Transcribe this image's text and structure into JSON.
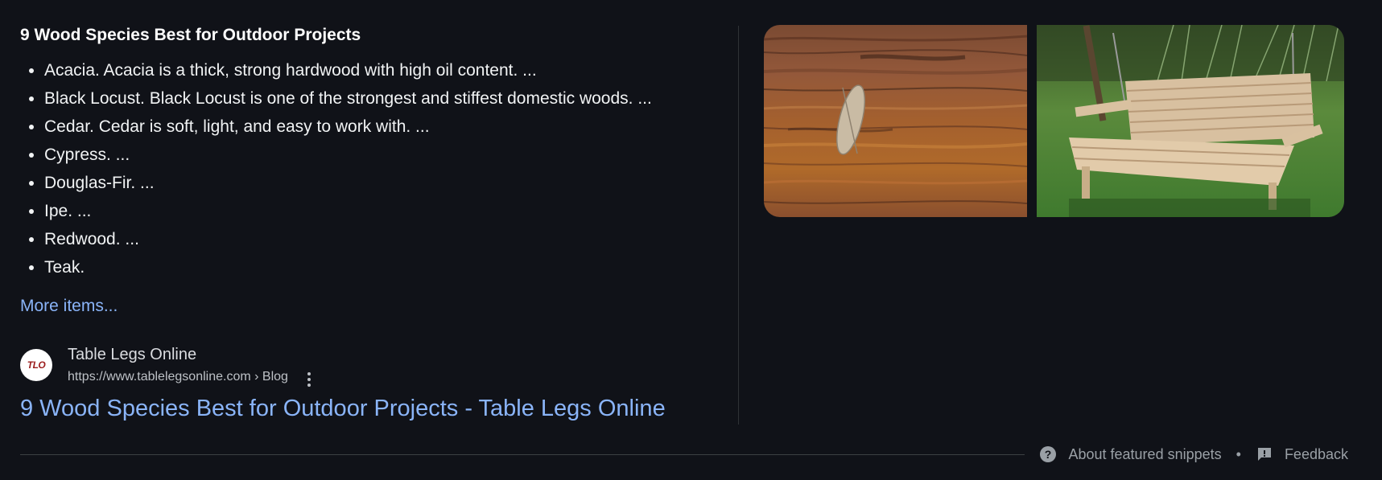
{
  "snippet": {
    "heading": "9 Wood Species Best for Outdoor Projects",
    "items": [
      "Acacia. Acacia is a thick, strong hardwood with high oil content. ...",
      "Black Locust. Black Locust is one of the strongest and stiffest domestic woods. ...",
      "Cedar. Cedar is soft, light, and easy to work with. ...",
      "Cypress. ...",
      "Douglas-Fir. ...",
      "Ipe. ...",
      "Redwood. ...",
      "Teak."
    ],
    "more_items": "More items..."
  },
  "source": {
    "favicon_text": "TLO",
    "name": "Table Legs Online",
    "url": "https://www.tablelegsonline.com › Blog",
    "menu_icon": "more-vert-icon"
  },
  "result": {
    "title": "9 Wood Species Best for Outdoor Projects - Table Legs Online"
  },
  "images": [
    {
      "subject": "weathered-wood-texture"
    },
    {
      "subject": "wooden-porch-swing"
    }
  ],
  "footer": {
    "about_label": "About featured snippets",
    "about_icon": "help-icon",
    "separator": "•",
    "feedback_label": "Feedback",
    "feedback_icon": "feedback-icon"
  },
  "colors": {
    "background": "#101218",
    "link": "#8ab4f8",
    "text": "#e8eaed",
    "muted": "#9aa0a6"
  }
}
